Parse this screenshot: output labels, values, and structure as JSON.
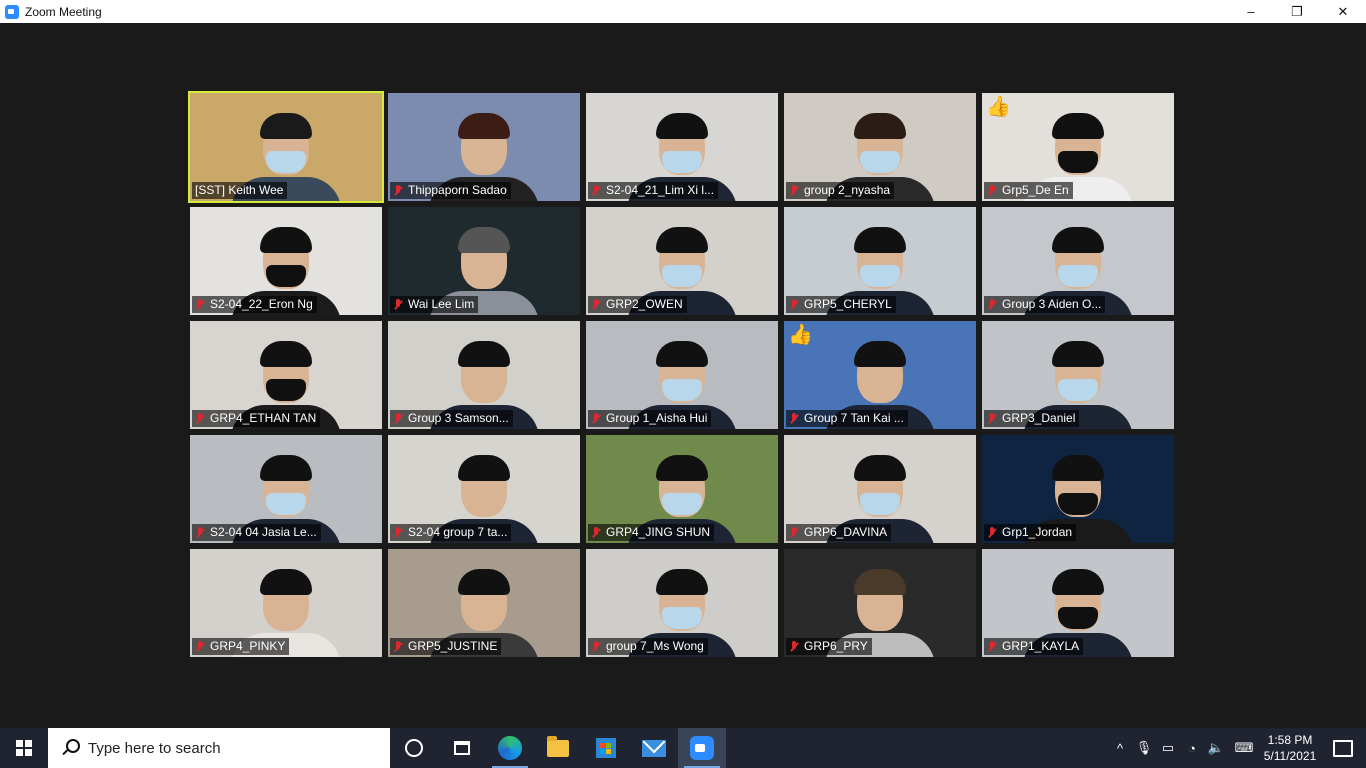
{
  "window": {
    "title": "Zoom Meeting",
    "minimize": "–",
    "restore": "❐",
    "close": "✕"
  },
  "participants": [
    {
      "name": "[SST] Keith Wee",
      "active": true,
      "muted": false,
      "mask": "light",
      "bg": "#c9a86a",
      "hair": "#1a1a1a",
      "body": "#3a4a5c",
      "thumb": false
    },
    {
      "name": "Thippaporn Sadao",
      "active": false,
      "muted": true,
      "mask": "none",
      "bg": "#7c8bb0",
      "hair": "#3b1d16",
      "body": "#222",
      "thumb": false
    },
    {
      "name": "S2-04_21_Lim Xi l...",
      "active": false,
      "muted": true,
      "mask": "light",
      "bg": "#d8d6d2",
      "hair": "#111",
      "body": "#1e2633",
      "thumb": false
    },
    {
      "name": "group 2_nyasha",
      "active": false,
      "muted": true,
      "mask": "light",
      "bg": "#cfcac4",
      "hair": "#2b1c16",
      "body": "#2a2a2a",
      "thumb": false
    },
    {
      "name": "Grp5_De En",
      "active": false,
      "muted": true,
      "mask": "black",
      "bg": "#e3e0dc",
      "hair": "#111",
      "body": "#eeeeee",
      "thumb": true
    },
    {
      "name": "S2-04_22_Eron Ng",
      "active": false,
      "muted": true,
      "mask": "black",
      "bg": "#e4e2df",
      "hair": "#111",
      "body": "#1c1c1c",
      "thumb": false
    },
    {
      "name": "Wai Lee Lim",
      "active": false,
      "muted": true,
      "mask": "none",
      "bg": "#1e2a2e",
      "hair": "#555",
      "body": "#8a8f99",
      "thumb": false
    },
    {
      "name": "GRP2_OWEN",
      "active": false,
      "muted": true,
      "mask": "light",
      "bg": "#d4d1cc",
      "hair": "#111",
      "body": "#1d2433",
      "thumb": false
    },
    {
      "name": "GRP5_CHERYL",
      "active": false,
      "muted": true,
      "mask": "light",
      "bg": "#c7ccd0",
      "hair": "#111",
      "body": "#1d2433",
      "thumb": false
    },
    {
      "name": "Group 3 Aiden O...",
      "active": false,
      "muted": true,
      "mask": "light",
      "bg": "#c4c8cc",
      "hair": "#111",
      "body": "#1d2433",
      "thumb": false
    },
    {
      "name": "GRP4_ETHAN TAN",
      "active": false,
      "muted": true,
      "mask": "black",
      "bg": "#d8d5d0",
      "hair": "#111",
      "body": "#1b1b1b",
      "thumb": false
    },
    {
      "name": "Group 3 Samson...",
      "active": false,
      "muted": true,
      "mask": "none",
      "bg": "#d2d0cb",
      "hair": "#111",
      "body": "#1d2433",
      "thumb": false
    },
    {
      "name": "Group 1_Aisha Hui",
      "active": false,
      "muted": true,
      "mask": "light",
      "bg": "#b8bcc0",
      "hair": "#111",
      "body": "#1d2433",
      "thumb": false
    },
    {
      "name": "Group 7 Tan Kai ...",
      "active": false,
      "muted": true,
      "mask": "none",
      "bg": "#4a74b8",
      "hair": "#111",
      "body": "#1d2433",
      "thumb": true
    },
    {
      "name": "GRP3_Daniel",
      "active": false,
      "muted": true,
      "mask": "light",
      "bg": "#c0c4c8",
      "hair": "#111",
      "body": "#1d2433",
      "thumb": false
    },
    {
      "name": "S2-04 04 Jasia Le...",
      "active": false,
      "muted": true,
      "mask": "light",
      "bg": "#b9bdc1",
      "hair": "#111",
      "body": "#1d2433",
      "thumb": false
    },
    {
      "name": "S2-04 group 7 ta...",
      "active": false,
      "muted": true,
      "mask": "none",
      "bg": "#d6d4cf",
      "hair": "#111",
      "body": "#1d2433",
      "thumb": false
    },
    {
      "name": "GRP4_JING SHUN",
      "active": false,
      "muted": true,
      "mask": "light",
      "bg": "#6f8a4a",
      "hair": "#111",
      "body": "#1d2433",
      "thumb": false
    },
    {
      "name": "GRP6_DAVINA",
      "active": false,
      "muted": true,
      "mask": "light",
      "bg": "#d5d2cd",
      "hair": "#111",
      "body": "#1d2433",
      "thumb": false
    },
    {
      "name": "Grp1_Jordan",
      "active": false,
      "muted": true,
      "mask": "black",
      "bg": "#0f2440",
      "hair": "#111",
      "body": "#1a1a1a",
      "thumb": false
    },
    {
      "name": "GRP4_PINKY",
      "active": false,
      "muted": true,
      "mask": "none",
      "bg": "#d4d0cc",
      "hair": "#111",
      "body": "#e8e4df",
      "thumb": false
    },
    {
      "name": "GRP5_JUSTINE",
      "active": false,
      "muted": true,
      "mask": "none",
      "bg": "#a89c8e",
      "hair": "#111",
      "body": "#3a3a3a",
      "thumb": false
    },
    {
      "name": "group 7_Ms Wong",
      "active": false,
      "muted": true,
      "mask": "light",
      "bg": "#cfcdc9",
      "hair": "#111",
      "body": "#1d2433",
      "thumb": false
    },
    {
      "name": "GRP6_PRY",
      "active": false,
      "muted": true,
      "mask": "none",
      "bg": "#2a2a2a",
      "hair": "#4a3a2a",
      "body": "#bdbdbd",
      "thumb": false
    },
    {
      "name": "GRP1_KAYLA",
      "active": false,
      "muted": true,
      "mask": "black",
      "bg": "#c2c6ca",
      "hair": "#111",
      "body": "#1d2433",
      "thumb": false
    }
  ],
  "taskbar": {
    "search_placeholder": "Type here to search",
    "clock_time": "1:58 PM",
    "clock_date": "5/11/2021"
  },
  "colors": {
    "active_speaker": "#d6ea3a",
    "muted_mic": "#e0262e",
    "taskbar": "#1f2430"
  }
}
